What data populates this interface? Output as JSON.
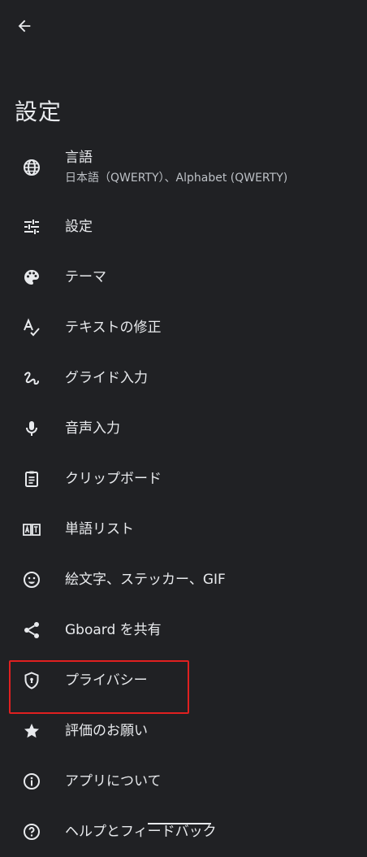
{
  "header": {
    "title": "設定"
  },
  "items": [
    {
      "label": "言語",
      "sub": "日本語（QWERTY）、Alphabet (QWERTY)",
      "icon": "globe-icon"
    },
    {
      "label": "設定",
      "icon": "tune-icon"
    },
    {
      "label": "テーマ",
      "icon": "palette-icon"
    },
    {
      "label": "テキストの修正",
      "icon": "spellcheck-icon"
    },
    {
      "label": "グライド入力",
      "icon": "gesture-icon"
    },
    {
      "label": "音声入力",
      "icon": "mic-icon"
    },
    {
      "label": "クリップボード",
      "icon": "clipboard-icon"
    },
    {
      "label": "単語リスト",
      "icon": "dictionary-icon"
    },
    {
      "label": "絵文字、ステッカー、GIF",
      "icon": "emoji-icon"
    },
    {
      "label": "Gboard を共有",
      "icon": "share-icon"
    },
    {
      "label": "プライバシー",
      "icon": "shield-icon"
    },
    {
      "label": "評価のお願い",
      "icon": "star-icon"
    },
    {
      "label": "アプリについて",
      "icon": "info-icon"
    },
    {
      "label": "ヘルプとフィードバック",
      "icon": "help-icon"
    }
  ],
  "colors": {
    "background": "#202124",
    "text": "#e8eaed",
    "highlight": "#e02020"
  }
}
